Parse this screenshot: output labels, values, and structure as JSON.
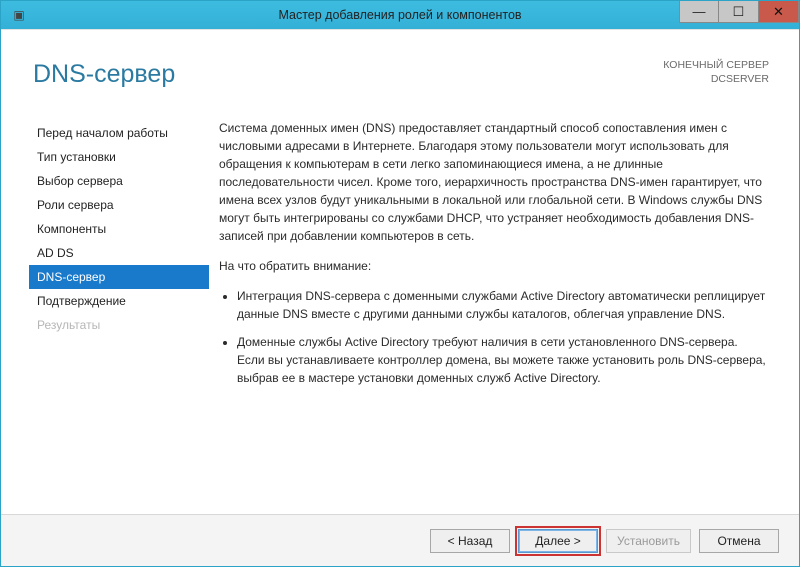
{
  "window": {
    "title": "Мастер добавления ролей и компонентов"
  },
  "header": {
    "page_title": "DNS-сервер",
    "dest_label": "КОНЕЧНЫЙ СЕРВЕР",
    "dest_value": "DCSERVER"
  },
  "sidebar": {
    "items": [
      {
        "label": "Перед началом работы",
        "state": "normal"
      },
      {
        "label": "Тип установки",
        "state": "normal"
      },
      {
        "label": "Выбор сервера",
        "state": "normal"
      },
      {
        "label": "Роли сервера",
        "state": "normal"
      },
      {
        "label": "Компоненты",
        "state": "normal"
      },
      {
        "label": "AD DS",
        "state": "normal"
      },
      {
        "label": "DNS-сервер",
        "state": "active"
      },
      {
        "label": "Подтверждение",
        "state": "normal"
      },
      {
        "label": "Результаты",
        "state": "disabled"
      }
    ]
  },
  "content": {
    "paragraph1": "Система доменных имен (DNS) предоставляет стандартный способ сопоставления имен с числовыми адресами в Интернете. Благодаря этому пользователи могут использовать для обращения к компьютерам в сети легко запоминающиеся имена, а не длинные последовательности чисел. Кроме того, иерархичность пространства DNS-имен гарантирует, что имена всех узлов будут уникальными в локальной или глобальной сети. В Windows службы DNS могут быть интегрированы со службами DHCP, что устраняет необходимость добавления DNS-записей при добавлении компьютеров в сеть.",
    "notes_title": "На что обратить внимание:",
    "bullets": [
      "Интеграция DNS-сервера с доменными службами Active Directory автоматически реплицирует данные DNS вместе с другими данными службы каталогов, облегчая управление DNS.",
      "Доменные службы Active Directory требуют наличия в сети установленного DNS-сервера. Если вы устанавливаете контроллер домена, вы можете также установить роль DNS-сервера, выбрав ее в мастере установки доменных служб Active Directory."
    ]
  },
  "footer": {
    "back": "< Назад",
    "next": "Далее >",
    "install": "Установить",
    "cancel": "Отмена"
  }
}
